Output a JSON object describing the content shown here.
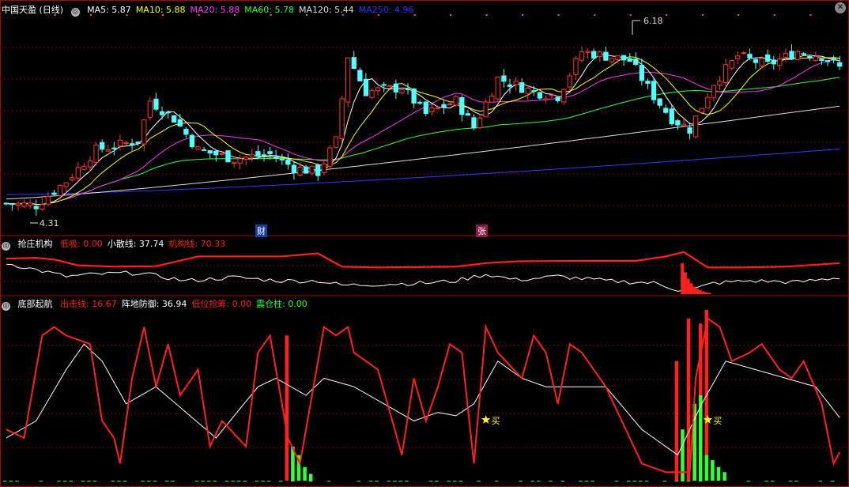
{
  "main_panel": {
    "title": "中国天盈 (日线)",
    "indicators": [
      {
        "label": "MA5: 5.87",
        "color": "#ffffff"
      },
      {
        "label": "MA10: 5.88",
        "color": "#ffff00"
      },
      {
        "label": "MA20: 5.88",
        "color": "#ff33ff"
      },
      {
        "label": "MA60: 5.78",
        "color": "#33ff33"
      },
      {
        "label": "MA120: 5.44",
        "color": "#dddddd"
      },
      {
        "label": "MA250: 4.96",
        "color": "#3333ff"
      }
    ],
    "high_label": "6.18",
    "low_label": "4.31",
    "event_tags": [
      "财",
      "张"
    ]
  },
  "panel2": {
    "title": "抢庄机构",
    "indicators": [
      {
        "label": "低吸: 0.00",
        "color": "#ff2020"
      },
      {
        "label": "小散线: 37.74",
        "color": "#ffffff"
      },
      {
        "label": "机构线: 70.33",
        "color": "#ff2020"
      }
    ]
  },
  "panel3": {
    "title": "底部起航",
    "indicators": [
      {
        "label": "出击线: 16.67",
        "color": "#ff2020"
      },
      {
        "label": "阵地防御: 36.94",
        "color": "#ffffff"
      },
      {
        "label": "低位抢筹: 0.00",
        "color": "#ff2020"
      },
      {
        "label": "震仓柱: 0.00",
        "color": "#33ff33"
      }
    ],
    "buy_labels": [
      "买",
      "买"
    ]
  },
  "colors": {
    "up": "#ff3333",
    "down": "#54ffff",
    "grid": "#8b0000",
    "border": "#aa0000"
  },
  "chart_data": {
    "type": "line",
    "price": {
      "type": "candlestick",
      "count": 140,
      "start_price": 4.35,
      "high": 6.18,
      "low": 4.31,
      "last_close": 5.87,
      "ylim": [
        4.15,
        6.45
      ],
      "moving_averages": {
        "MA5": 5.87,
        "MA10": 5.88,
        "MA20": 5.88,
        "MA60": 5.78,
        "MA120": 5.44,
        "MA250": 4.96
      },
      "key_points": [
        [
          0,
          4.35
        ],
        [
          5,
          4.33
        ],
        [
          10,
          4.6
        ],
        [
          15,
          4.95
        ],
        [
          22,
          5.05
        ],
        [
          24,
          5.5
        ],
        [
          28,
          5.3
        ],
        [
          32,
          4.95
        ],
        [
          38,
          4.85
        ],
        [
          44,
          4.9
        ],
        [
          48,
          4.75
        ],
        [
          52,
          4.7
        ],
        [
          55,
          5.05
        ],
        [
          57,
          6.0
        ],
        [
          60,
          5.6
        ],
        [
          66,
          5.65
        ],
        [
          70,
          5.35
        ],
        [
          75,
          5.5
        ],
        [
          78,
          5.2
        ],
        [
          82,
          5.75
        ],
        [
          88,
          5.6
        ],
        [
          92,
          5.55
        ],
        [
          96,
          6.05
        ],
        [
          100,
          6.0
        ],
        [
          104,
          5.95
        ],
        [
          108,
          5.55
        ],
        [
          111,
          5.3
        ],
        [
          114,
          5.18
        ],
        [
          118,
          5.7
        ],
        [
          122,
          6.0
        ],
        [
          127,
          5.9
        ],
        [
          132,
          6.05
        ],
        [
          136,
          6.0
        ],
        [
          139,
          5.87
        ]
      ]
    },
    "panel2_series": {
      "机构线": {
        "last": 70.33,
        "ylim": [
          0,
          100
        ],
        "points": [
          [
            0,
            80
          ],
          [
            5,
            82
          ],
          [
            8,
            78
          ],
          [
            12,
            65
          ],
          [
            18,
            62
          ],
          [
            25,
            63
          ],
          [
            32,
            85
          ],
          [
            38,
            85
          ],
          [
            46,
            85
          ],
          [
            52,
            92
          ],
          [
            56,
            62
          ],
          [
            62,
            60
          ],
          [
            75,
            62
          ],
          [
            80,
            70
          ],
          [
            85,
            74
          ],
          [
            95,
            75
          ],
          [
            105,
            75
          ],
          [
            110,
            85
          ],
          [
            113,
            95
          ],
          [
            117,
            60
          ],
          [
            122,
            60
          ],
          [
            130,
            62
          ],
          [
            139,
            70
          ]
        ]
      },
      "小散线": {
        "last": 37.74,
        "ylim": [
          0,
          100
        ],
        "points": [
          [
            0,
            70
          ],
          [
            5,
            55
          ],
          [
            10,
            40
          ],
          [
            15,
            45
          ],
          [
            22,
            48
          ],
          [
            30,
            30
          ],
          [
            38,
            38
          ],
          [
            46,
            30
          ],
          [
            52,
            30
          ],
          [
            56,
            20
          ],
          [
            62,
            22
          ],
          [
            70,
            25
          ],
          [
            75,
            30
          ],
          [
            80,
            45
          ],
          [
            85,
            32
          ],
          [
            92,
            40
          ],
          [
            100,
            30
          ],
          [
            108,
            25
          ],
          [
            112,
            10
          ],
          [
            115,
            12
          ],
          [
            118,
            25
          ],
          [
            124,
            30
          ],
          [
            132,
            27
          ],
          [
            139,
            37.74
          ]
        ]
      },
      "低吸": {
        "last": 0,
        "peak": [
          113,
          70
        ]
      }
    },
    "panel3_series": {
      "出击线": {
        "last": 16.67,
        "ylim": [
          0,
          100
        ],
        "points": [
          [
            0,
            30
          ],
          [
            3,
            25
          ],
          [
            6,
            85
          ],
          [
            8,
            90
          ],
          [
            10,
            85
          ],
          [
            14,
            80
          ],
          [
            16,
            35
          ],
          [
            18,
            25
          ],
          [
            19,
            10
          ],
          [
            21,
            60
          ],
          [
            23,
            90
          ],
          [
            25,
            55
          ],
          [
            27,
            80
          ],
          [
            29,
            50
          ],
          [
            32,
            65
          ],
          [
            34,
            20
          ],
          [
            36,
            35
          ],
          [
            40,
            20
          ],
          [
            42,
            75
          ],
          [
            44,
            85
          ],
          [
            47,
            25
          ],
          [
            49,
            10
          ],
          [
            51,
            50
          ],
          [
            53,
            90
          ],
          [
            55,
            85
          ],
          [
            57,
            90
          ],
          [
            58,
            75
          ],
          [
            60,
            70
          ],
          [
            62,
            65
          ],
          [
            64,
            40
          ],
          [
            66,
            15
          ],
          [
            68,
            60
          ],
          [
            70,
            35
          ],
          [
            72,
            55
          ],
          [
            74,
            80
          ],
          [
            76,
            75
          ],
          [
            78,
            10
          ],
          [
            80,
            90
          ],
          [
            82,
            75
          ],
          [
            86,
            60
          ],
          [
            88,
            85
          ],
          [
            90,
            75
          ],
          [
            92,
            45
          ],
          [
            94,
            80
          ],
          [
            96,
            75
          ],
          [
            98,
            65
          ],
          [
            100,
            55
          ],
          [
            102,
            40
          ],
          [
            104,
            25
          ],
          [
            106,
            10
          ],
          [
            110,
            5
          ],
          [
            112,
            5
          ],
          [
            114,
            5
          ],
          [
            115,
            60
          ],
          [
            117,
            95
          ],
          [
            119,
            90
          ],
          [
            121,
            70
          ],
          [
            124,
            75
          ],
          [
            126,
            80
          ],
          [
            129,
            65
          ],
          [
            131,
            60
          ],
          [
            133,
            70
          ],
          [
            136,
            45
          ],
          [
            138,
            10
          ],
          [
            139,
            16.67
          ]
        ]
      },
      "阵地防御": {
        "last": 36.94,
        "ylim": [
          0,
          100
        ],
        "points": [
          [
            0,
            25
          ],
          [
            5,
            35
          ],
          [
            10,
            65
          ],
          [
            13,
            80
          ],
          [
            16,
            70
          ],
          [
            20,
            45
          ],
          [
            25,
            55
          ],
          [
            30,
            40
          ],
          [
            35,
            25
          ],
          [
            42,
            55
          ],
          [
            45,
            60
          ],
          [
            50,
            50
          ],
          [
            53,
            60
          ],
          [
            58,
            55
          ],
          [
            63,
            45
          ],
          [
            68,
            35
          ],
          [
            72,
            40
          ],
          [
            75,
            38
          ],
          [
            78,
            45
          ],
          [
            82,
            70
          ],
          [
            86,
            60
          ],
          [
            90,
            55
          ],
          [
            95,
            55
          ],
          [
            100,
            55
          ],
          [
            106,
            30
          ],
          [
            112,
            15
          ],
          [
            116,
            45
          ],
          [
            120,
            70
          ],
          [
            125,
            65
          ],
          [
            130,
            60
          ],
          [
            135,
            55
          ],
          [
            139,
            36.94
          ]
        ]
      },
      "低位抢筹": {
        "last": 0,
        "bars": [
          [
            47,
            85
          ],
          [
            112,
            70
          ],
          [
            114,
            95
          ],
          [
            116,
            92
          ],
          [
            117,
            100
          ],
          [
            115,
            35
          ]
        ]
      },
      "震仓柱": {
        "last": 0,
        "bars": [
          [
            48,
            20
          ],
          [
            49,
            15
          ],
          [
            50,
            8
          ],
          [
            51,
            4
          ],
          [
            113,
            30
          ],
          [
            115,
            45
          ],
          [
            116,
            50
          ],
          [
            117,
            15
          ],
          [
            118,
            12
          ],
          [
            119,
            8
          ],
          [
            120,
            5
          ]
        ]
      },
      "buy_signals": [
        80,
        117
      ]
    }
  }
}
